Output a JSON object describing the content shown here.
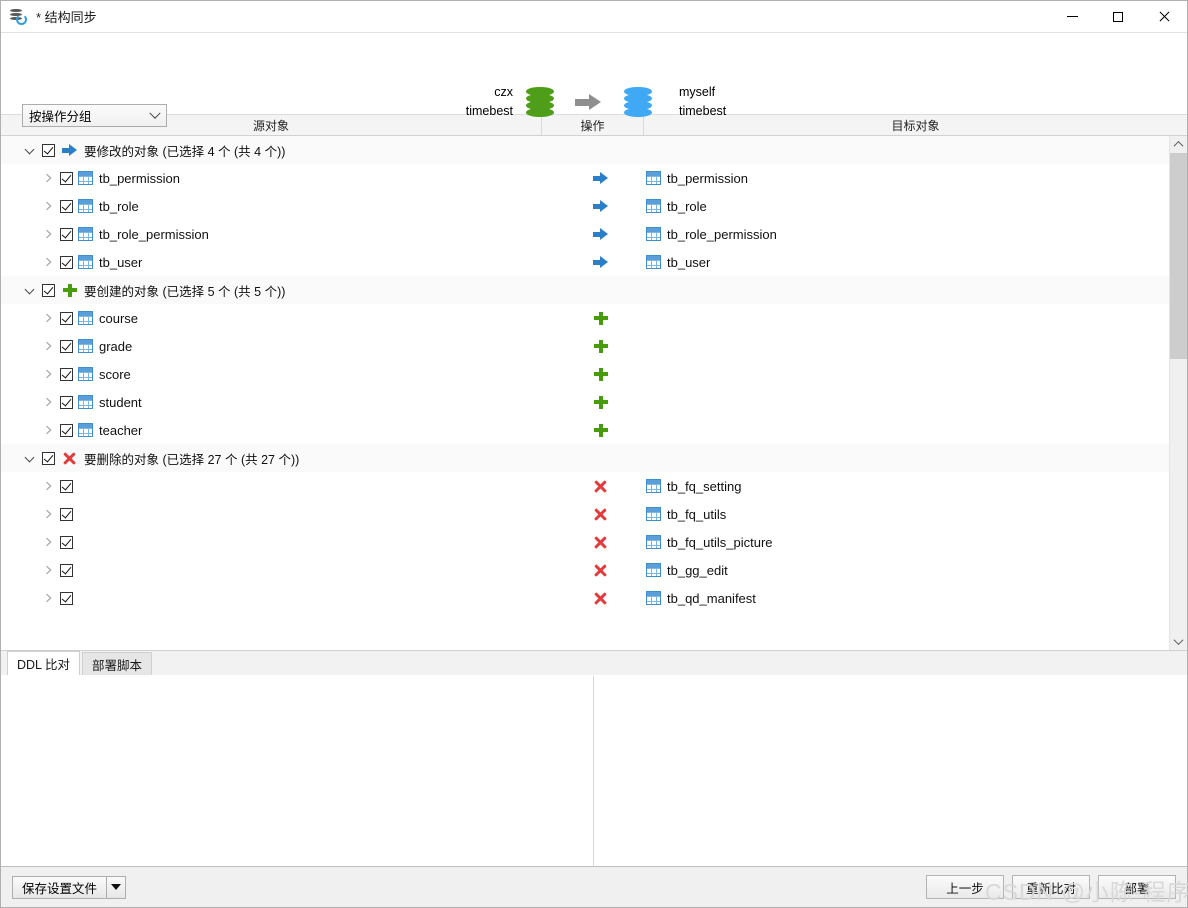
{
  "window": {
    "title": "* 结构同步",
    "icon": "database-sync-icon",
    "minimize_label": "—",
    "maximize_label": "□",
    "close_label": "✕"
  },
  "toolbar": {
    "group_select_value": "按操作分组"
  },
  "connection": {
    "source": {
      "connection": "czx",
      "database": "timebest",
      "icon_color": "#4f9e19"
    },
    "target": {
      "connection": "myself",
      "database": "timebest",
      "icon_color": "#3fa9f5"
    },
    "arrow_color": "#8e8e8e"
  },
  "tree": {
    "columns": {
      "source": "源对象",
      "operation": "操作",
      "target": "目标对象"
    },
    "groups": [
      {
        "label": "要修改的对象 (已选择 4 个 (共 4 个))",
        "op_icon": "arrow-right-icon",
        "checked": true,
        "expanded": true,
        "rows": [
          {
            "source": "tb_permission",
            "target": "tb_permission",
            "op": "arrow-right-icon",
            "checked": true
          },
          {
            "source": "tb_role",
            "target": "tb_role",
            "op": "arrow-right-icon",
            "checked": true
          },
          {
            "source": "tb_role_permission",
            "target": "tb_role_permission",
            "op": "arrow-right-icon",
            "checked": true
          },
          {
            "source": "tb_user",
            "target": "tb_user",
            "op": "arrow-right-icon",
            "checked": true
          }
        ]
      },
      {
        "label": "要创建的对象 (已选择 5 个 (共 5 个))",
        "op_icon": "plus-icon",
        "checked": true,
        "expanded": true,
        "rows": [
          {
            "source": "course",
            "target": "",
            "op": "plus-icon",
            "checked": true
          },
          {
            "source": "grade",
            "target": "",
            "op": "plus-icon",
            "checked": true
          },
          {
            "source": "score",
            "target": "",
            "op": "plus-icon",
            "checked": true
          },
          {
            "source": "student",
            "target": "",
            "op": "plus-icon",
            "checked": true
          },
          {
            "source": "teacher",
            "target": "",
            "op": "plus-icon",
            "checked": true
          }
        ]
      },
      {
        "label": "要删除的对象 (已选择 27 个 (共 27 个))",
        "op_icon": "cross-icon",
        "checked": true,
        "expanded": true,
        "rows": [
          {
            "source": "",
            "target": "tb_fq_setting",
            "op": "cross-icon",
            "checked": true
          },
          {
            "source": "",
            "target": "tb_fq_utils",
            "op": "cross-icon",
            "checked": true
          },
          {
            "source": "",
            "target": "tb_fq_utils_picture",
            "op": "cross-icon",
            "checked": true
          },
          {
            "source": "",
            "target": "tb_gg_edit",
            "op": "cross-icon",
            "checked": true
          },
          {
            "source": "",
            "target": "tb_qd_manifest",
            "op": "cross-icon",
            "checked": true
          }
        ]
      }
    ]
  },
  "bottom_tabs": [
    {
      "label": "DDL 比对",
      "active": true
    },
    {
      "label": "部署脚本",
      "active": false
    }
  ],
  "footer": {
    "save_settings_label": "保存设置文件",
    "prev_label": "上一步",
    "recompare_label": "重新比对",
    "deploy_label": "部署"
  },
  "watermark": "CSDN @小陈-程序员",
  "colors": {
    "modify": "#2b7fc9",
    "create": "#479c0e",
    "delete": "#e23b3b",
    "table_icon": "#3f8fd0"
  }
}
